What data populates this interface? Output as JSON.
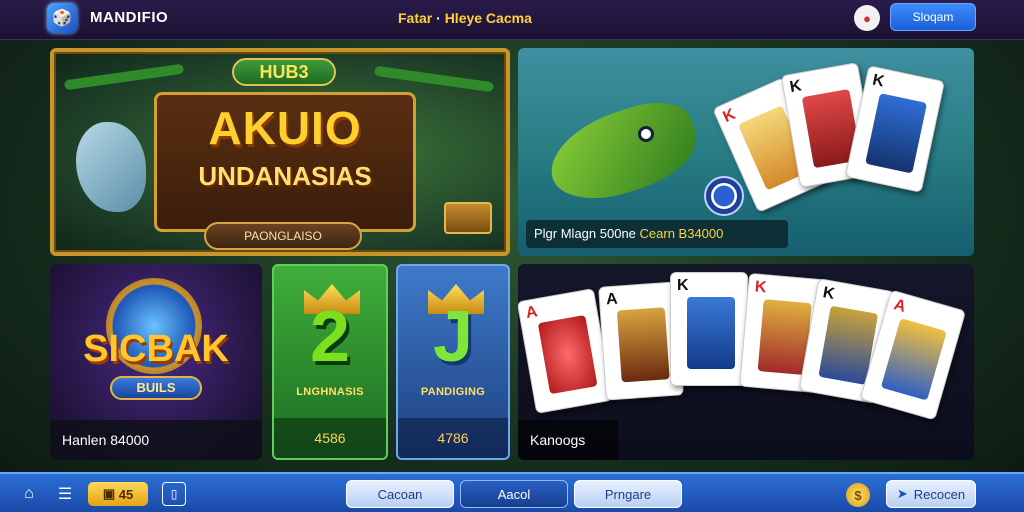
{
  "header": {
    "app_name": "MANDIFIO",
    "title_left": "Fatar",
    "title_sep": "·",
    "title_right": "Hleye Cacma",
    "signin_label": "Sloqam"
  },
  "tiles": {
    "featured": {
      "brand": "HUB3",
      "title_line1": "AKUIO",
      "title_line2": "UNDANASIAS",
      "button": "PAONGLAISO"
    },
    "fishing": {
      "caption": "Plgr Mlagn 500ne",
      "amount": "Cearn B34000"
    },
    "sicbo": {
      "name": "SICBAK",
      "sub": "BUILS",
      "footer": "Hanlen 84000"
    },
    "two": {
      "glyph": "2",
      "label": "LNGHNASIS",
      "footer": "4586"
    },
    "jack": {
      "glyph": "J",
      "label": "PANDIGING",
      "footer": "4786"
    },
    "cards": {
      "footer": "Kanoogs",
      "ranks": [
        "A",
        "A",
        "K",
        "K",
        "K",
        "A"
      ]
    },
    "fishing_cards": {
      "ranks": [
        "K",
        "K",
        "K"
      ]
    }
  },
  "bottombar": {
    "badge_count": "45",
    "btn1": "Cacoan",
    "btn2": "Aacol",
    "btn3": "Prngare",
    "coin_symbol": "$",
    "btn_right": "Recocen"
  },
  "colors": {
    "accent_gold": "#ffd23a",
    "header_bg": "#2a1b4a",
    "bottombar_bg": "#2c6fd6"
  }
}
